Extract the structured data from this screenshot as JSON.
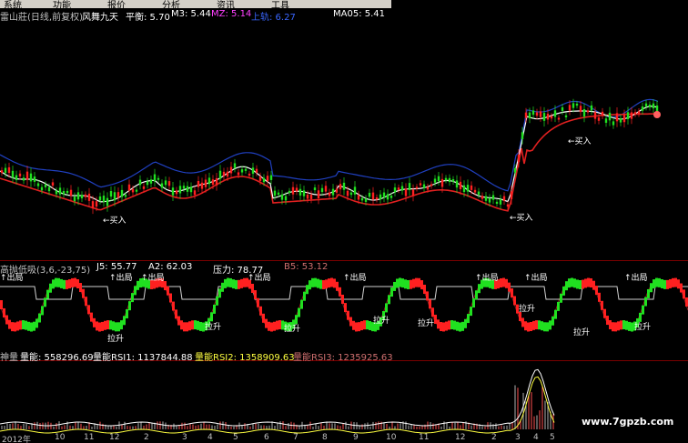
{
  "menu": [
    "系统",
    "功能",
    "报价",
    "分析",
    "资讯",
    "工具"
  ],
  "main_header": {
    "name": "雷山莊(日线,前复权)",
    "indicator": "风舞九天",
    "balance": "平衡: 5.70",
    "m3": "M3: 5.44",
    "mz": "MZ: 5.14",
    "up": "上轨: 6.27",
    "ma05": "MA05: 5.41"
  },
  "main_annotations": [
    "←买入",
    "←买入",
    "←买入"
  ],
  "mid_header": {
    "name": "高抛低吸(3,6,-23,75)",
    "j": "J5: 55.77",
    "a2": "A2: 62.03",
    "pressure": "压力: 78.77",
    "b5": "B5: 53.12"
  },
  "mid_labels": {
    "top": [
      "↑出局",
      "↑出局",
      "↑出局",
      "↑出局",
      "↑出局",
      "↑出局",
      "↑出局",
      "↑出局"
    ],
    "bottom": [
      "拉升",
      "拉升",
      "拉升",
      "拉升",
      "拉升",
      "拉升",
      "拉升",
      "拉升"
    ]
  },
  "vol_header": {
    "name": "神量",
    "v": "量能: 558296.69",
    "rsi1": "量能RSI1: 1137844.88",
    "rsi2": "量能RSI2: 1358909.63",
    "rsi3": "量能RSI3: 1235925.63"
  },
  "x_ticks": [
    "2012年",
    "10",
    "11",
    "12",
    "2",
    "3",
    "4",
    "5",
    "6",
    "7",
    "8",
    "9",
    "10",
    "11",
    "12",
    "2",
    "3",
    "4",
    "5"
  ],
  "watermark": "www.7gpzb.com",
  "colors": {
    "up": "#ff2020",
    "down": "#20e020",
    "ma_red": "#e02020",
    "band_blue": "#2040c0",
    "white": "#ffffff",
    "yellow": "#ffff40"
  }
}
